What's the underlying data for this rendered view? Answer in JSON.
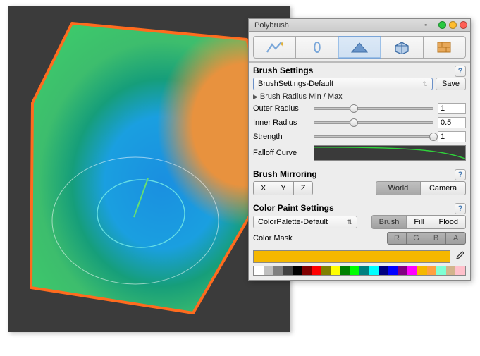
{
  "window": {
    "title": "Polybrush"
  },
  "tools": [
    {
      "name": "sculpt",
      "selected": false
    },
    {
      "name": "smooth",
      "selected": false
    },
    {
      "name": "paint",
      "selected": true
    },
    {
      "name": "prefab",
      "selected": false
    },
    {
      "name": "texture",
      "selected": false
    }
  ],
  "brush": {
    "heading": "Brush Settings",
    "preset": "BrushSettings-Default",
    "save_label": "Save",
    "foldout": "Brush Radius Min / Max",
    "outer": {
      "label": "Outer Radius",
      "value": "1",
      "pos": 0.3
    },
    "inner": {
      "label": "Inner Radius",
      "value": "0.5",
      "pos": 0.3
    },
    "strength": {
      "label": "Strength",
      "value": "1",
      "pos": 0.98
    },
    "falloff_label": "Falloff Curve"
  },
  "mirror": {
    "heading": "Brush Mirroring",
    "axes": [
      "X",
      "Y",
      "Z"
    ],
    "space": {
      "world": "World",
      "camera": "Camera",
      "selected": "world"
    }
  },
  "color": {
    "heading": "Color Paint Settings",
    "palette_preset": "ColorPalette-Default",
    "modes": {
      "brush": "Brush",
      "fill": "Fill",
      "flood": "Flood",
      "selected": "brush"
    },
    "mask_label": "Color Mask",
    "mask": [
      "R",
      "G",
      "B",
      "A"
    ],
    "active_swatch": "#f5b800",
    "palette": [
      "#ffffff",
      "#bfbfbf",
      "#808080",
      "#404040",
      "#000000",
      "#800000",
      "#ff0000",
      "#808000",
      "#ffff00",
      "#008000",
      "#00ff00",
      "#008080",
      "#00ffff",
      "#000080",
      "#0000ff",
      "#800080",
      "#ff00ff",
      "#f5b800",
      "#ffa040",
      "#7fffd4",
      "#d2b48c",
      "#ffc0cb"
    ]
  }
}
